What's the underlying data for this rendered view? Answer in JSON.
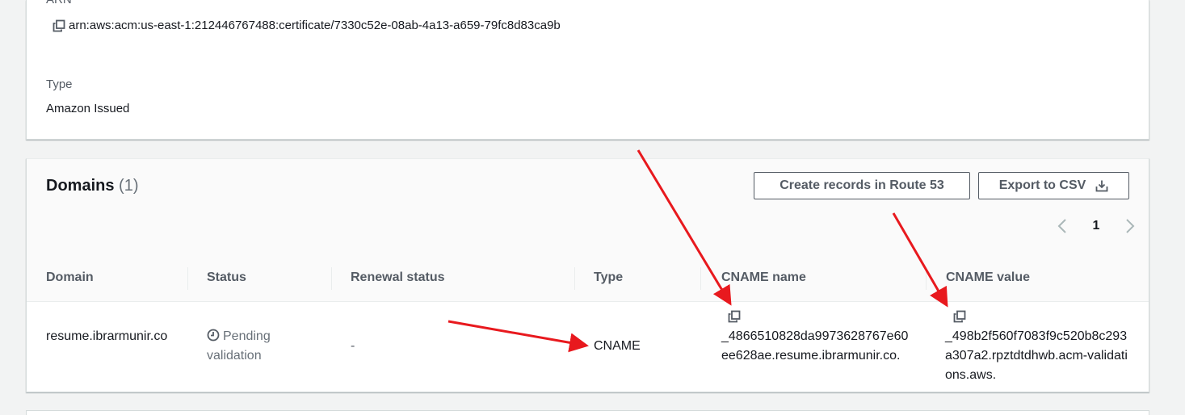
{
  "details": {
    "arn_label": "ARN",
    "arn_value": "arn:aws:acm:us-east-1:212446767488:certificate/7330c52e-08ab-4a13-a659-79fc8d83ca9b",
    "type_label": "Type",
    "type_value": "Amazon Issued"
  },
  "domains": {
    "title": "Domains",
    "count": "(1)",
    "create_records_button": "Create records in Route 53",
    "export_button": "Export to CSV",
    "pagination": {
      "current_page": "1"
    },
    "columns": [
      "Domain",
      "Status",
      "Renewal status",
      "Type",
      "CNAME name",
      "CNAME value"
    ],
    "rows": [
      {
        "domain": "resume.ibrarmunir.co",
        "status": "Pending validation",
        "renewal_status": "-",
        "type": "CNAME",
        "cname_name": "_4866510828da9973628767e60ee628ae.resume.ibrarmunir.co.",
        "cname_value": "_498b2f560f7083f9c520b8c293a307a2.rpztdtdhwb.acm-validations.aws."
      }
    ]
  },
  "colors": {
    "page_background": "#f2f3f3",
    "panel_background": "#ffffff",
    "text_primary": "#16191f",
    "text_secondary": "#545b64",
    "annotation_arrow": "#e8191e"
  },
  "icons": {
    "copy": "copy-icon",
    "status_pending": "clock-icon",
    "download": "download-icon",
    "pager_prev": "chevron-left-icon",
    "pager_next": "chevron-right-icon"
  }
}
